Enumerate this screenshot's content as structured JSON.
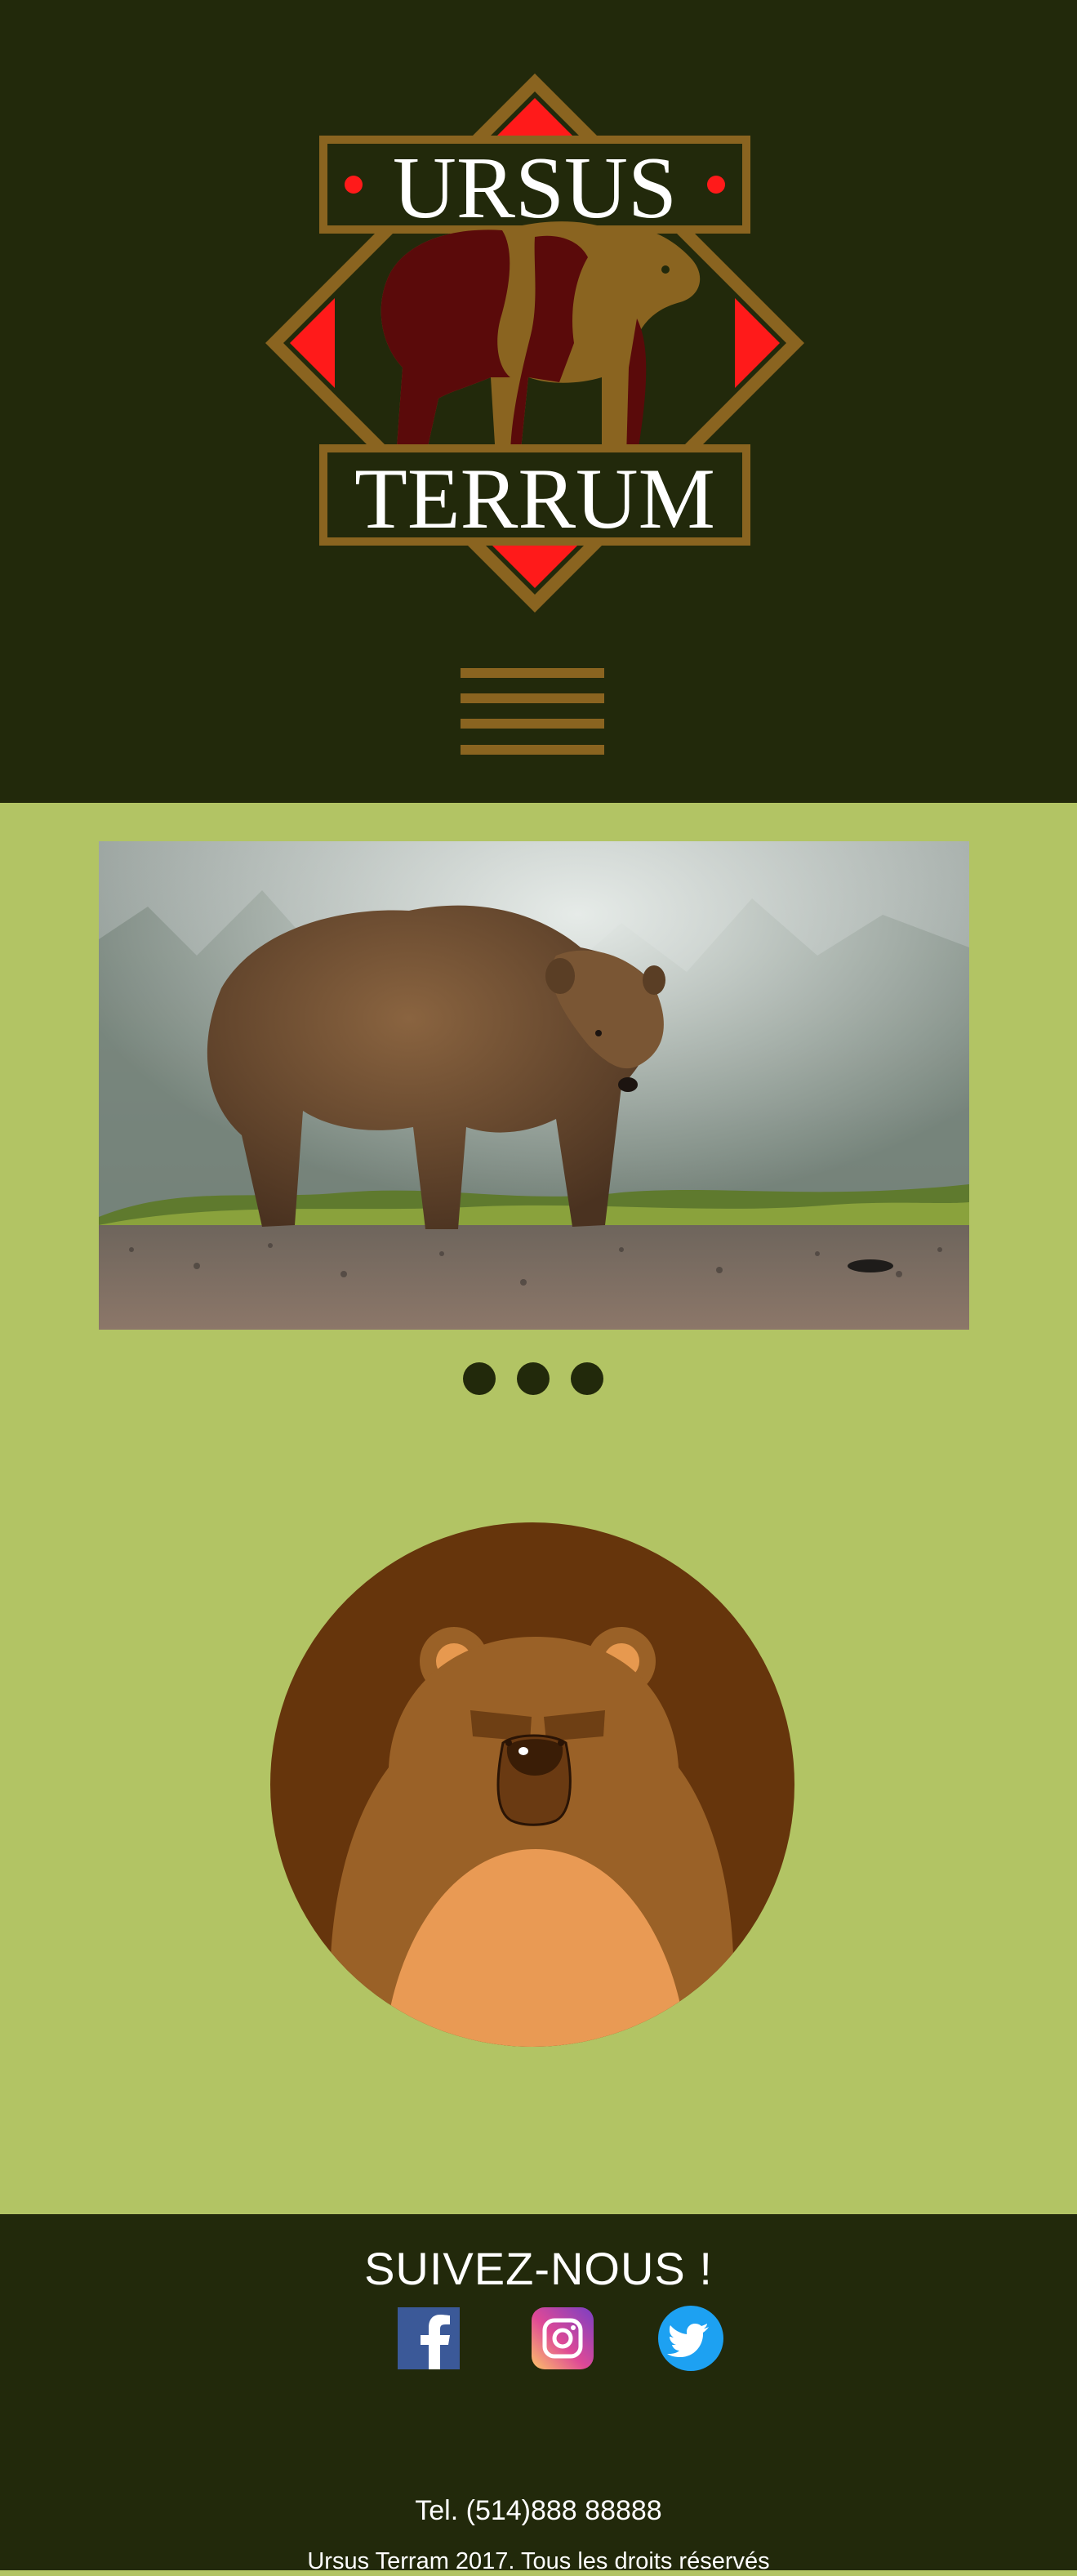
{
  "header": {
    "logo_line1": "URSUS",
    "logo_line2": "TERRUM",
    "logo_name": "ursus-terrum-logo",
    "menu_icon": "hamburger-menu-icon"
  },
  "slider": {
    "image": "grizzly-bear-photo",
    "dots": [
      "slide-1",
      "slide-2",
      "slide-3"
    ]
  },
  "mascot": {
    "image": "bear-face-illustration"
  },
  "footer": {
    "title": "SUIVEZ-NOUS !",
    "social": [
      {
        "name": "facebook-icon",
        "color": "#3b5998"
      },
      {
        "name": "instagram-icon",
        "color": "#c13584"
      },
      {
        "name": "twitter-icon",
        "color": "#1da1f2"
      }
    ],
    "phone": "Tel. (514)888 88888",
    "copyright": "Ursus Terram 2017. Tous les droits réservés"
  },
  "colors": {
    "header_bg": "#22290b",
    "page_bg": "#b2c464",
    "logo_gold": "#8a6420",
    "logo_red": "#ff1a1a",
    "bear_dark": "#5a0a0a"
  }
}
